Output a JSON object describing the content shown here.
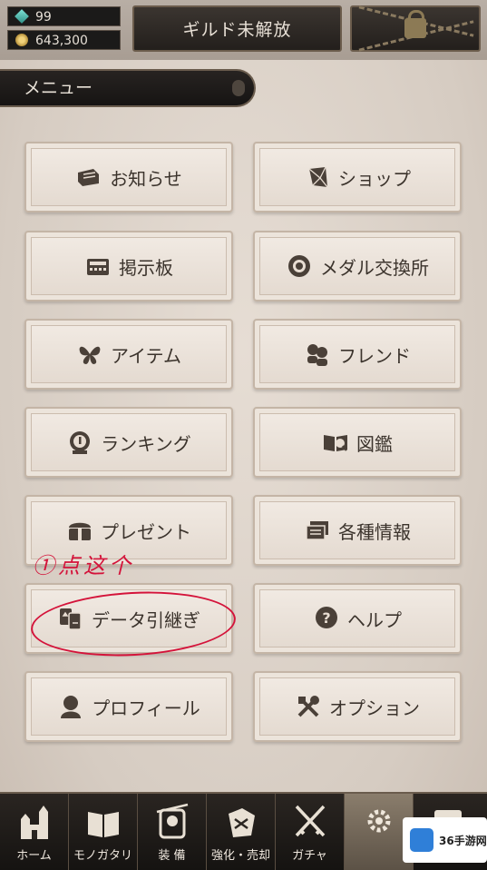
{
  "top": {
    "gems": "99",
    "coins": "643,300",
    "guild_label": "ギルド未解放"
  },
  "menu": {
    "title": "メニュー",
    "items": [
      {
        "label": "お知らせ",
        "icon": "letter-icon"
      },
      {
        "label": "ショップ",
        "icon": "crystal-icon"
      },
      {
        "label": "掲示板",
        "icon": "board-icon"
      },
      {
        "label": "メダル交換所",
        "icon": "medal-icon"
      },
      {
        "label": "アイテム",
        "icon": "butterfly-icon"
      },
      {
        "label": "フレンド",
        "icon": "friends-icon"
      },
      {
        "label": "ランキング",
        "icon": "ranking-icon"
      },
      {
        "label": "図鑑",
        "icon": "book-icon"
      },
      {
        "label": "プレゼント",
        "icon": "present-icon"
      },
      {
        "label": "各種情報",
        "icon": "info-icon"
      },
      {
        "label": "データ引継ぎ",
        "icon": "transfer-icon"
      },
      {
        "label": "ヘルプ",
        "icon": "help-icon"
      },
      {
        "label": "プロフィール",
        "icon": "profile-icon"
      },
      {
        "label": "オプション",
        "icon": "tools-icon"
      }
    ]
  },
  "annotation": {
    "text": "①点这个",
    "color": "#d4133a"
  },
  "nav": {
    "items": [
      {
        "label": "ホーム",
        "icon": "castle-icon"
      },
      {
        "label": "モノガタリ",
        "icon": "open-book-icon"
      },
      {
        "label": "装 備",
        "icon": "equipment-icon"
      },
      {
        "label": "強化・売却",
        "icon": "enhance-icon"
      },
      {
        "label": "ガチャ",
        "icon": "swords-icon"
      }
    ]
  },
  "watermark": {
    "text": "36手游网"
  }
}
